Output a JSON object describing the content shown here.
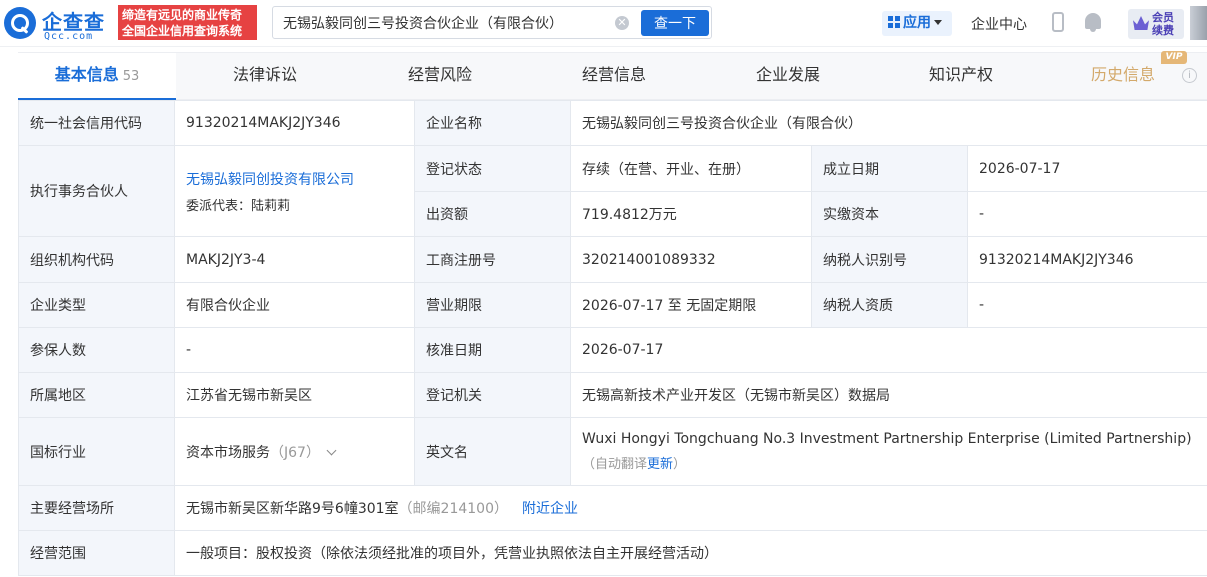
{
  "header": {
    "logo_cn": "企查查",
    "logo_en": "Qcc.com",
    "slogan_line1": "缔造有远见的商业传奇",
    "slogan_line2": "全国企业信用查询系统",
    "search_value": "无锡弘毅同创三号投资合伙企业（有限合伙）",
    "search_button": "查一下",
    "apps_label": "应用",
    "company_center": "企业中心",
    "member_line1": "会员",
    "member_line2": "续费"
  },
  "tabs": [
    {
      "label": "基本信息",
      "count": "53"
    },
    {
      "label": "法律诉讼"
    },
    {
      "label": "经营风险"
    },
    {
      "label": "经营信息"
    },
    {
      "label": "企业发展"
    },
    {
      "label": "知识产权"
    },
    {
      "label": "历史信息",
      "badge": "VIP"
    }
  ],
  "info": {
    "credit_code_label": "统一社会信用代码",
    "credit_code": "91320214MAKJ2JY346",
    "name_label": "企业名称",
    "name": "无锡弘毅同创三号投资合伙企业（有限合伙）",
    "partner_label": "执行事务合伙人",
    "partner_name": "无锡弘毅同创投资有限公司",
    "partner_rep": "委派代表：陆莉莉",
    "status_label": "登记状态",
    "status": "存续（在营、开业、在册）",
    "founded_label": "成立日期",
    "founded": "2026-07-17",
    "capital_label": "出资额",
    "capital": "719.4812万元",
    "paid_label": "实缴资本",
    "paid": "-",
    "org_code_label": "组织机构代码",
    "org_code": "MAKJ2JY3-4",
    "reg_no_label": "工商注册号",
    "reg_no": "320214001089332",
    "tax_id_label": "纳税人识别号",
    "tax_id": "91320214MAKJ2JY346",
    "type_label": "企业类型",
    "type": "有限合伙企业",
    "term_label": "营业期限",
    "term": "2026-07-17 至 无固定期限",
    "tax_qual_label": "纳税人资质",
    "tax_qual": "-",
    "insured_label": "参保人数",
    "insured": "-",
    "approved_label": "核准日期",
    "approved": "2026-07-17",
    "region_label": "所属地区",
    "region": "江苏省无锡市新吴区",
    "authority_label": "登记机关",
    "authority": "无锡高新技术产业开发区（无锡市新吴区）数据局",
    "industry_label": "国标行业",
    "industry": "资本市场服务",
    "industry_code": "（J67）",
    "english_label": "英文名",
    "english_name": "Wuxi Hongyi Tongchuang No.3 Investment Partnership Enterprise (Limited Partnership)",
    "auto_translate": "（自动翻译",
    "update_link": "更新",
    "auto_translate_end": "）",
    "address_label": "主要经营场所",
    "address": "无锡市新吴区新华路9号6幢301室",
    "postcode": "（邮编214100）",
    "nearby_link": "附近企业",
    "scope_label": "经营范围",
    "scope": "一般项目：股权投资（除依法须经批准的项目外，凭营业执照依法自主开展经营活动）"
  }
}
